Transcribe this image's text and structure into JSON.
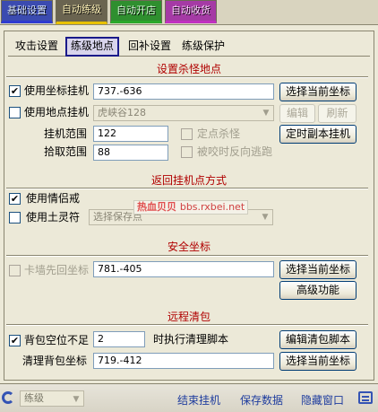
{
  "top_tabs": [
    "基础设置",
    "自动练级",
    "自动开店",
    "自动收货"
  ],
  "sub_tabs": [
    "攻击设置",
    "练级地点",
    "回补设置",
    "练级保护"
  ],
  "section_spot": {
    "title": "设置杀怪地点",
    "use_coord": {
      "label": "使用坐标挂机",
      "checked": true,
      "value": "737.-636",
      "button": "选择当前坐标"
    },
    "use_place": {
      "label": "使用地点挂机",
      "checked": false,
      "value": "虎峡谷128",
      "edit": "编辑",
      "refresh": "刷新"
    },
    "range": {
      "label": "挂机范围",
      "value": "122"
    },
    "pickup": {
      "label": "拾取范围",
      "value": "88"
    },
    "fixed_kill": {
      "label": "定点杀怪",
      "checked": false
    },
    "reverse_escape": {
      "label": "被咬时反向逃跑",
      "checked": false
    },
    "timed_dungeon_button": "定时副本挂机"
  },
  "section_return": {
    "title": "返回挂机点方式",
    "use_ring": {
      "label": "使用情侣戒",
      "checked": true
    },
    "use_talisman": {
      "label": "使用土灵符",
      "checked": false,
      "select_placeholder": "选择保存点"
    },
    "watermark": {
      "text": "热血贝贝",
      "domain": "bbs.rxbei.net"
    }
  },
  "section_safe": {
    "title": "安全坐标",
    "stuck_return": {
      "label": "卡墙先回坐标",
      "checked": false,
      "value": "781.-405",
      "button": "选择当前坐标"
    },
    "advanced_button": "高级功能"
  },
  "section_clean": {
    "title": "远程清包",
    "bag_free": {
      "label": "背包空位不足",
      "checked": true,
      "value": "2",
      "suffix": "时执行清理脚本",
      "button": "编辑清包脚本"
    },
    "clean_coord": {
      "label": "清理背包坐标",
      "value": "719.-412",
      "button": "选择当前坐标"
    }
  },
  "bottom": {
    "select_value": "练级",
    "links": [
      "结束挂机",
      "保存数据",
      "隐藏窗口"
    ]
  }
}
